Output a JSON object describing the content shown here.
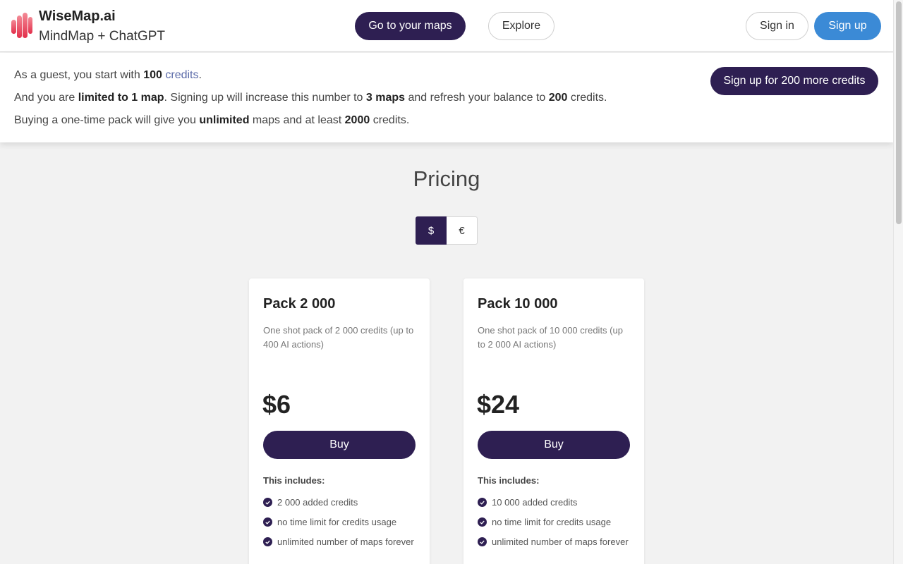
{
  "brand": {
    "name": "WiseMap.ai",
    "tagline": "MindMap + ChatGPT",
    "logo_colors": [
      "#f07f8c",
      "#e8364f"
    ]
  },
  "nav": {
    "maps_label": "Go to your maps",
    "explore_label": "Explore",
    "signin_label": "Sign in",
    "signup_label": "Sign up"
  },
  "banner": {
    "line1": {
      "a": "As a guest, you start with ",
      "b": "100",
      "c": " ",
      "link": "credits",
      "d": "."
    },
    "line2": {
      "a": "And you are ",
      "b": "limited to 1 map",
      "c": ". Signing up will increase this number to ",
      "d": "3 maps",
      "e": " and refresh your balance to ",
      "f": "200",
      "g": " credits."
    },
    "line3": {
      "a": "Buying a one-time pack will give you ",
      "b": "unlimited",
      "c": " maps and at least ",
      "d": "2000",
      "e": " credits."
    },
    "cta_label": "Sign up for 200 more credits"
  },
  "pricing": {
    "title": "Pricing",
    "currencies": [
      "$",
      "€"
    ],
    "selected_currency": "$",
    "cards": [
      {
        "title": "Pack 2 000",
        "description": "One shot pack of 2 000 credits (up to 400 AI actions)",
        "price": "$6",
        "buy_label": "Buy",
        "includes_label": "This includes:",
        "features": [
          "2 000 added credits",
          "no time limit for credits usage",
          "unlimited number of maps forever"
        ]
      },
      {
        "title": "Pack 10 000",
        "description": "One shot pack of 10 000 credits (up to 2 000 AI actions)",
        "price": "$24",
        "buy_label": "Buy",
        "includes_label": "This includes:",
        "features": [
          "10 000 added credits",
          "no time limit for credits usage",
          "unlimited number of maps forever"
        ]
      }
    ]
  },
  "colors": {
    "primary_dark": "#2e1f52",
    "signup_blue": "#3b8ad6",
    "link": "#5a6aa8",
    "page_bg": "#f2f2f2"
  },
  "icons": {
    "logo": "wisemap-logo-icon",
    "check": "check-circle-icon"
  }
}
